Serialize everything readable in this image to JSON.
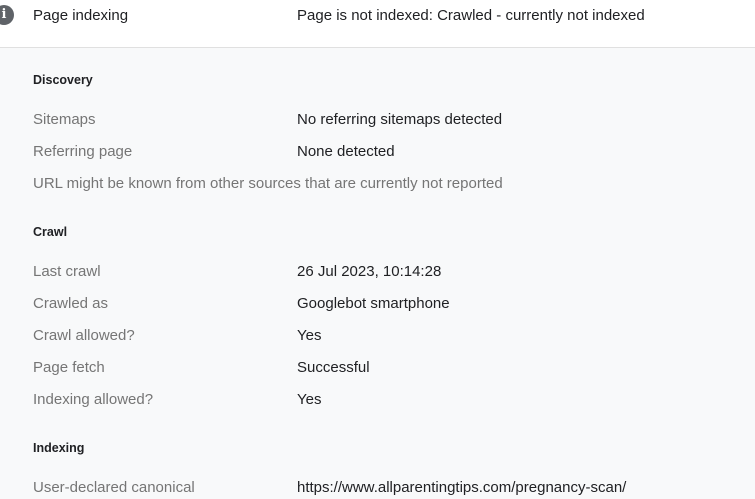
{
  "header": {
    "icon": "info-icon",
    "label": "Page indexing",
    "value": "Page is not indexed: Crawled - currently not indexed"
  },
  "discovery": {
    "title": "Discovery",
    "rows": [
      {
        "label": "Sitemaps",
        "value": "No referring sitemaps detected"
      },
      {
        "label": "Referring page",
        "value": "None detected"
      }
    ],
    "note": "URL might be known from other sources that are currently not reported"
  },
  "crawl": {
    "title": "Crawl",
    "rows": [
      {
        "label": "Last crawl",
        "value": "26 Jul 2023, 10:14:28"
      },
      {
        "label": "Crawled as",
        "value": "Googlebot smartphone"
      },
      {
        "label": "Crawl allowed?",
        "value": "Yes"
      },
      {
        "label": "Page fetch",
        "value": "Successful"
      },
      {
        "label": "Indexing allowed?",
        "value": "Yes"
      }
    ]
  },
  "indexing": {
    "title": "Indexing",
    "rows": [
      {
        "label": "User-declared canonical",
        "value": "https://www.allparentingtips.com/pregnancy-scan/"
      }
    ]
  },
  "colors": {
    "label_gray": "#757575",
    "text_dark": "#202124",
    "panel_bg": "#f8f9fa",
    "icon_bg": "#5f6368"
  }
}
